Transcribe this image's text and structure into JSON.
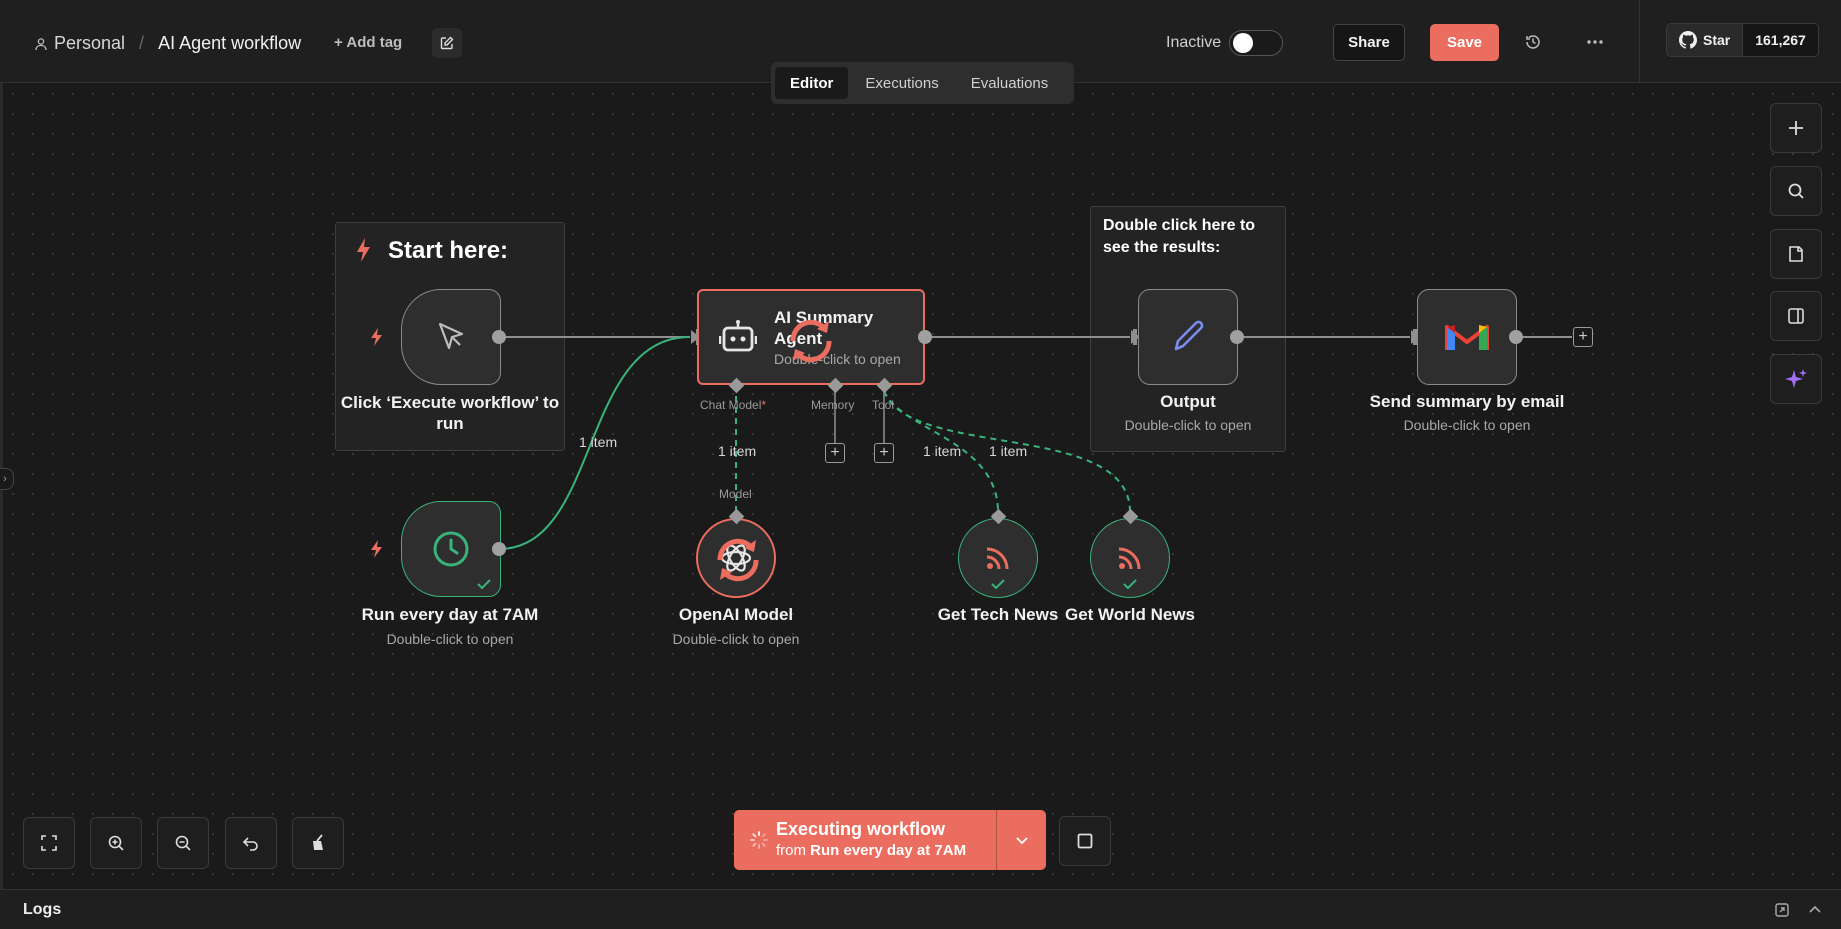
{
  "header": {
    "project": "Personal",
    "workflow_title": "AI Agent workflow",
    "add_tag": "+ Add tag",
    "status_label": "Inactive",
    "share": "Share",
    "save": "Save",
    "github_star": "Star",
    "github_count": "161,267"
  },
  "tabs": [
    "Editor",
    "Executions",
    "Evaluations"
  ],
  "canvas": {
    "sticky_start": "Start here:",
    "sticky_output": "Double click here to see the results:",
    "nodes": {
      "manual": {
        "label": "Click ‘Execute workflow’ to run"
      },
      "schedule": {
        "label": "Run every day at 7AM",
        "sub": "Double-click to open"
      },
      "agent": {
        "label": "AI Summary Agent",
        "sub": "Double-click to open"
      },
      "openai": {
        "label": "OpenAI Model",
        "sub": "Double-click to open"
      },
      "tech": {
        "label": "Get Tech News"
      },
      "world": {
        "label": "Get World News"
      },
      "output": {
        "label": "Output",
        "sub": "Double-click to open"
      },
      "gmail": {
        "label": "Send summary by email",
        "sub": "Double-click to open"
      }
    },
    "ports": {
      "chat_model": "Chat Model",
      "required_mark": "*",
      "memory": "Memory",
      "tool": "Tool",
      "model": "Model"
    },
    "edge_labels": {
      "schedule_agent": "1 item",
      "model": "1 item",
      "tool_tech": "1 item",
      "tool_world": "1 item"
    }
  },
  "execution": {
    "title": "Executing workflow",
    "from_prefix": "from",
    "from_node": "Run every day at 7AM"
  },
  "logs": {
    "label": "Logs"
  },
  "colors": {
    "accent": "#ea6d5f",
    "success": "#39b37a",
    "ai_purple": "#a36cf7"
  }
}
